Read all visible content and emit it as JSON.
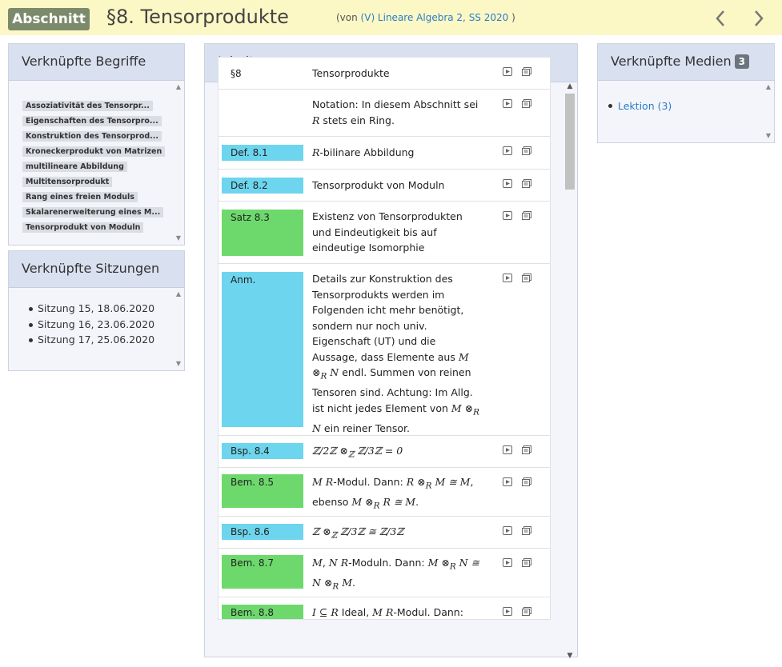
{
  "header": {
    "badge": "Abschnitt",
    "title": "§8. Tensorprodukte",
    "context_prefix": "(von ",
    "context_link": "(V) Lineare Algebra 2, SS 2020",
    "context_suffix": " )"
  },
  "begriffe": {
    "title": "Verknüpfte Begriffe",
    "tags": [
      "Assoziativität des Tensorpr...",
      "Eigenschaften des Tensorpro...",
      "Konstruktion des Tensorprod...",
      "Kroneckerprodukt von Matrizen",
      "multilineare Abbildung",
      "Multitensorprodukt",
      "Rang eines freien Moduls",
      "Skalarenerweiterung eines M...",
      "Tensorprodukt von Moduln"
    ]
  },
  "sitzungen": {
    "title": "Verknüpfte Sitzungen",
    "items": [
      "Sitzung 15, 18.06.2020",
      "Sitzung 16, 23.06.2020",
      "Sitzung 17, 25.06.2020"
    ]
  },
  "medien": {
    "title": "Verknüpfte Medien",
    "count": "3",
    "items": [
      "Lektion (3)"
    ]
  },
  "inhalt": {
    "title": "Inhalt",
    "rows": [
      {
        "number": "§8",
        "text": "Tensorprodukte"
      },
      {
        "number": "",
        "text": "Notation: In diesem Abschnitt sei R stets ein Ring."
      },
      {
        "number": "Def. 8.1",
        "text": "R-bilinare Abbildung"
      },
      {
        "number": "Def. 8.2",
        "text": "Tensorprodukt von Moduln"
      },
      {
        "number": "Satz 8.3",
        "text": "Existenz von Tensorprodukten und Eindeutigkeit bis auf eindeutige Isomorphie"
      },
      {
        "number": "Anm.",
        "text": "Details zur Konstruktion des Tensorprodukts werden im Folgenden icht mehr benötigt, sondern nur noch univ. Eigenschaft (UT) und die Aussage, dass Elemente aus M ⊗R N endl. Summen von reinen Tensoren sind. Achtung: Im Allg. ist nicht jedes Element von M ⊗R N ein reiner Tensor."
      },
      {
        "number": "Bsp. 8.4",
        "text": "ℤ/2ℤ ⊗ℤ ℤ/3ℤ = 0"
      },
      {
        "number": "Bem. 8.5",
        "text": "M R-Modul. Dann: R ⊗R M ≅ M, ebenso M ⊗R R ≅ M."
      },
      {
        "number": "Bsp. 8.6",
        "text": "ℤ ⊗ℤ ℤ/3ℤ ≅ ℤ/3ℤ"
      },
      {
        "number": "Bem. 8.7",
        "text": "M, N R-Moduln. Dann: M ⊗R N ≅ N ⊗R M."
      },
      {
        "number": "Bem. 8.8",
        "text": "I ⊆ R Ideal, M R-Modul. Dann:"
      }
    ]
  },
  "icons": {
    "nav_prev": "chevron-left-icon",
    "nav_next": "chevron-right-icon",
    "video": "video-icon",
    "document": "document-icon"
  },
  "colors": {
    "header_bg": "#fcf8c6",
    "badge_bg": "#7c8a6c",
    "definition": "#6dd5ed",
    "theorem": "#6dd96d",
    "link": "#2c7bc7"
  }
}
